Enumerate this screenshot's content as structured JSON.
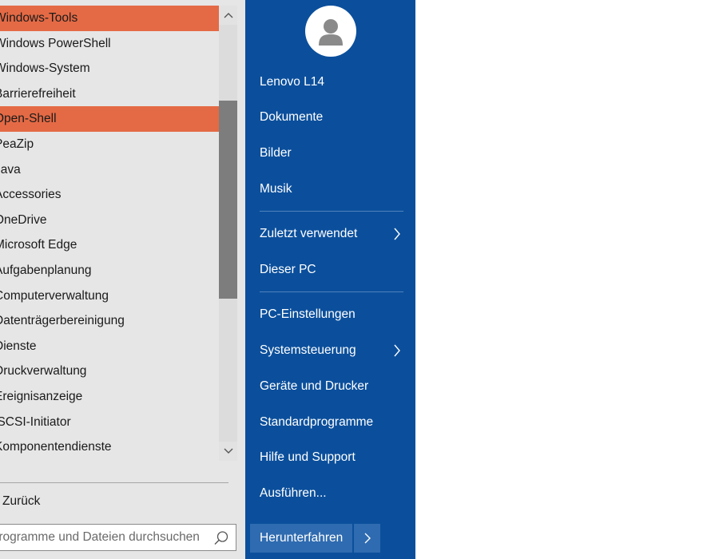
{
  "programs": [
    {
      "label": "Windows-Tools",
      "highlighted": true
    },
    {
      "label": "Windows PowerShell",
      "highlighted": false
    },
    {
      "label": "Windows-System",
      "highlighted": false
    },
    {
      "label": "Barrierefreiheit",
      "highlighted": false
    },
    {
      "label": "Open-Shell",
      "highlighted": true
    },
    {
      "label": "PeaZip",
      "highlighted": false
    },
    {
      "label": "Java",
      "highlighted": false
    },
    {
      "label": "Accessories",
      "highlighted": false
    },
    {
      "label": "OneDrive",
      "highlighted": false
    },
    {
      "label": "Microsoft Edge",
      "highlighted": false
    },
    {
      "label": "Aufgabenplanung",
      "highlighted": false
    },
    {
      "label": "Computerverwaltung",
      "highlighted": false
    },
    {
      "label": "Datenträgerbereinigung",
      "highlighted": false
    },
    {
      "label": "Dienste",
      "highlighted": false
    },
    {
      "label": "Druckverwaltung",
      "highlighted": false
    },
    {
      "label": "Ereignisanzeige",
      "highlighted": false
    },
    {
      "label": "iSCSI-Initiator",
      "highlighted": false
    },
    {
      "label": "Komponentendienste",
      "highlighted": false
    }
  ],
  "back_label": "Zurück",
  "search": {
    "placeholder": "Programme und Dateien durchsuchen"
  },
  "right_menu": {
    "user_name": "Lenovo L14",
    "items_group1": [
      "Dokumente",
      "Bilder",
      "Musik"
    ],
    "recent": "Zuletzt verwendet",
    "this_pc": "Dieser PC",
    "settings": "PC-Einstellungen",
    "control_panel": "Systemsteuerung",
    "devices": "Geräte und Drucker",
    "default_programs": "Standardprogramme",
    "help": "Hilfe und Support",
    "run": "Ausführen..."
  },
  "shutdown_label": "Herunterfahren",
  "colors": {
    "accent": "#0b4f9c",
    "highlight": "#e46a45",
    "panel": "#e6e6e6"
  }
}
